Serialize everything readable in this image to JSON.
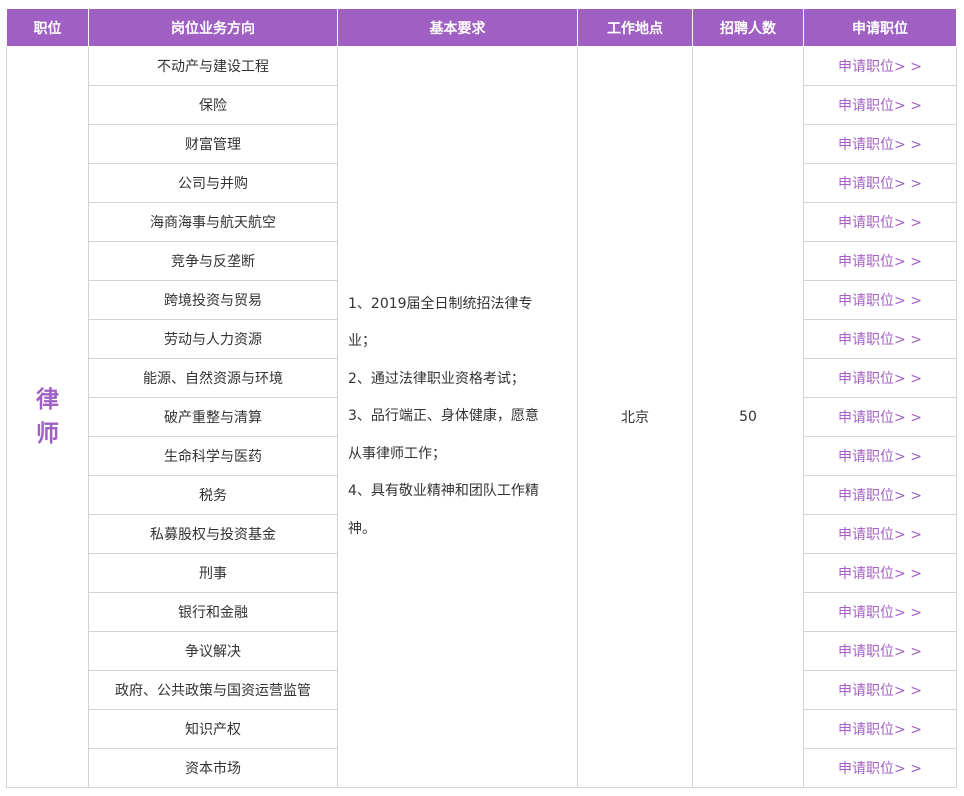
{
  "header": {
    "position": "职位",
    "direction": "岗位业务方向",
    "requirements": "基本要求",
    "location": "工作地点",
    "headcount": "招聘人数",
    "apply": "申请职位"
  },
  "position": {
    "chars": [
      "律",
      "师"
    ]
  },
  "requirements": [
    "1、2019届全日制统招法律专",
    "业；",
    "2、通过法律职业资格考试；",
    "3、品行端正、身体健康，愿意",
    "从事律师工作；",
    "4、具有敬业精神和团队工作精",
    "神。"
  ],
  "location": "北京",
  "headcount": "50",
  "apply_link_label": "申请职位> >",
  "directions": [
    "不动产与建设工程",
    "保险",
    "财富管理",
    "公司与并购",
    "海商海事与航天航空",
    "竞争与反垄断",
    "跨境投资与贸易",
    "劳动与人力资源",
    "能源、自然资源与环境",
    "破产重整与清算",
    "生命科学与医药",
    "税务",
    "私募股权与投资基金",
    "刑事",
    "银行和金融",
    "争议解决",
    "政府、公共政策与国资运营监管",
    "知识产权",
    "资本市场"
  ],
  "colors": {
    "accent": "#9f5fc3",
    "link": "#a55fc7",
    "border": "#d3d3d3"
  }
}
